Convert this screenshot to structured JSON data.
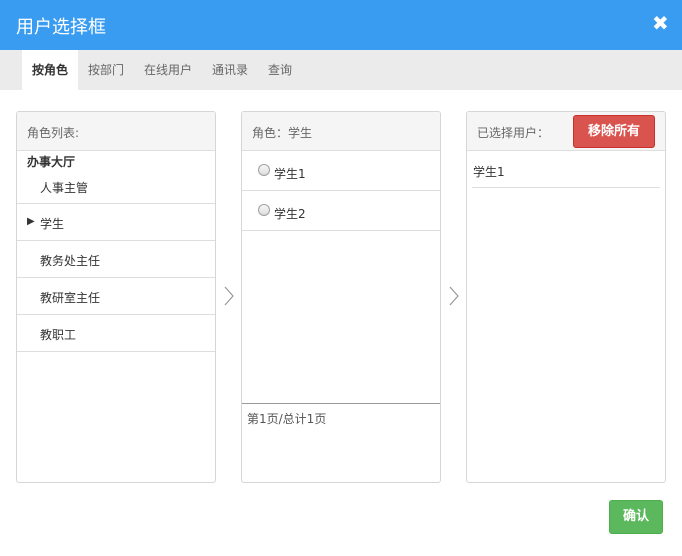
{
  "dialog": {
    "title": "用户选择框",
    "close_glyph": "✖"
  },
  "tabs": [
    {
      "label": "按角色",
      "active": true
    },
    {
      "label": "按部门",
      "active": false
    },
    {
      "label": "在线用户",
      "active": false
    },
    {
      "label": "通讯录",
      "active": false
    },
    {
      "label": "查询",
      "active": false
    }
  ],
  "role_panel": {
    "header": "角色列表:",
    "group": "办事大厅",
    "items": [
      {
        "label": "人事主管",
        "selected": false
      },
      {
        "label": "学生",
        "selected": true
      },
      {
        "label": "教务处主任",
        "selected": false
      },
      {
        "label": "教研室主任",
        "selected": false
      },
      {
        "label": "教职工",
        "selected": false
      }
    ],
    "selected_marker": "▶"
  },
  "user_panel": {
    "header": "角色：学生",
    "users": [
      "学生1",
      "学生2"
    ],
    "pagination": "第1页/总计1页"
  },
  "selected_panel": {
    "header": "已选择用户：",
    "remove_all_label": "移除所有",
    "users": [
      "学生1"
    ]
  },
  "footer": {
    "confirm_label": "确认"
  },
  "colors": {
    "titlebar": "#3a9cf1",
    "remove_button": "#d9534f",
    "confirm_button": "#5cb85c"
  }
}
